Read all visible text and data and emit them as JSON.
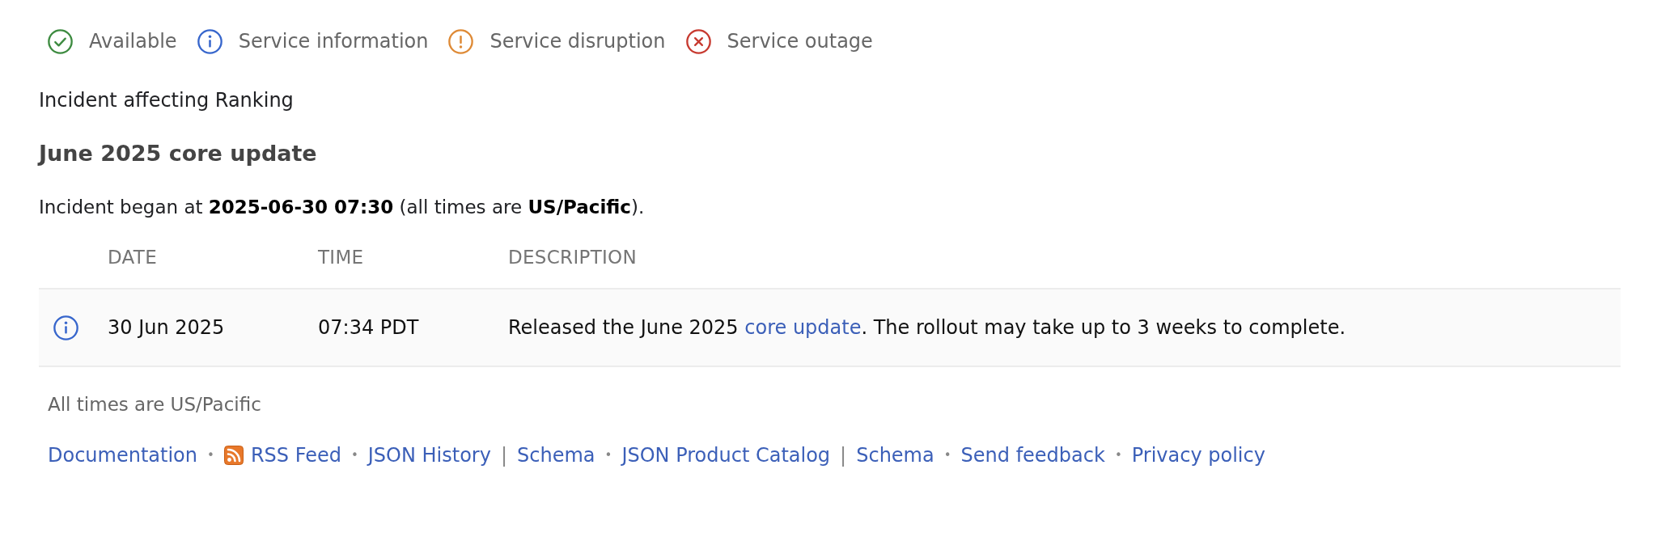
{
  "legend": [
    {
      "kind": "available",
      "label": "Available"
    },
    {
      "kind": "information",
      "label": "Service information"
    },
    {
      "kind": "disruption",
      "label": "Service disruption"
    },
    {
      "kind": "outage",
      "label": "Service outage"
    }
  ],
  "incident": {
    "affecting": "Incident affecting Ranking",
    "title": "June 2025 core update",
    "began": "Incident began at **2025-06-30 07:30** (all times are **US/Pacific**)."
  },
  "table": {
    "columns": [
      "DATE",
      "TIME",
      "DESCRIPTION"
    ],
    "rows": [
      {
        "kind": "information",
        "date": "30 Jun 2025",
        "time": "07:34 PDT",
        "description": {
          "before": "Released the June 2025 ",
          "link": "core update",
          "after": ". The rollout may take up to 3 weeks to complete."
        }
      }
    ]
  },
  "timezone_note": "All times are US/Pacific",
  "footer": [
    {
      "kind": "link",
      "text": "Documentation"
    },
    {
      "kind": "separator",
      "text": "•"
    },
    {
      "kind": "feed_link",
      "text": "RSS Feed"
    },
    {
      "kind": "separator",
      "text": "•"
    },
    {
      "kind": "link",
      "text": "JSON History"
    },
    {
      "kind": "separator",
      "text": "|"
    },
    {
      "kind": "link",
      "text": "Schema"
    },
    {
      "kind": "separator",
      "text": "•"
    },
    {
      "kind": "link",
      "text": "JSON Product Catalog"
    },
    {
      "kind": "separator",
      "text": "|"
    },
    {
      "kind": "link",
      "text": "Schema"
    },
    {
      "kind": "separator",
      "text": "•"
    },
    {
      "kind": "link",
      "text": "Send feedback"
    },
    {
      "kind": "separator",
      "text": "•"
    },
    {
      "kind": "link",
      "text": "Privacy policy"
    }
  ]
}
